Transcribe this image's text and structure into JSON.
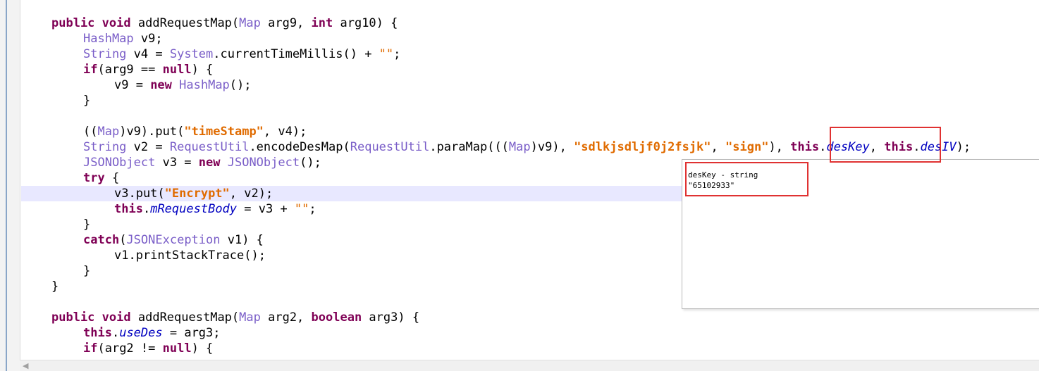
{
  "code": {
    "l1": {
      "kw1": "public",
      "kw2": "void",
      "name": " addRequestMap(",
      "ty": "Map",
      "a": " arg9, ",
      "kw3": "int",
      "b": " arg10) {"
    },
    "l2": {
      "ty": "HashMap",
      "rest": " v9;"
    },
    "l3": {
      "ty1": "String",
      "a": " v4 = ",
      "ty2": "System",
      "b": ".currentTimeMillis() + ",
      "str": "\"\"",
      "c": ";"
    },
    "l4": {
      "kw": "if",
      "a": "(arg9 == ",
      "kw2": "null",
      "b": ") {"
    },
    "l5": {
      "a": "v9 = ",
      "kw": "new",
      "ty": " HashMap",
      "b": "();"
    },
    "l6": {
      "a": "}"
    },
    "l7": {
      "a": "((",
      "ty": "Map",
      "b": ")v9).put(",
      "str": "\"timeStamp\"",
      "c": ", v4);"
    },
    "l8": {
      "ty1": "String",
      "a": " v2 = ",
      "ty2": "RequestUtil",
      "b": ".encodeDesMap(",
      "ty3": "RequestUtil",
      "c": ".paraMap(((",
      "ty4": "Map",
      "d": ")v9), ",
      "str1": "\"sdlkjsdljf0j2fsjk\"",
      "e": ", ",
      "str2": "\"sign\"",
      "f": "), ",
      "kw1": "this",
      "g": ".",
      "fld1": "desKey",
      "h": ", ",
      "kw2": "this",
      "i": ".",
      "fld2": "desIV",
      "j": ");"
    },
    "l9": {
      "ty1": "JSONObject",
      "a": " v3 = ",
      "kw": "new",
      "ty2": " JSONObject",
      "b": "();"
    },
    "l10": {
      "kw": "try",
      "a": " {"
    },
    "l11": {
      "a": "v3.put(",
      "str": "\"Encrypt\"",
      "b": ", v2);"
    },
    "l12": {
      "kw": "this",
      "a": ".",
      "fld": "mRequestBody",
      "b": " = v3 + ",
      "str": "\"\"",
      "c": ";"
    },
    "l13": {
      "a": "}"
    },
    "l14": {
      "kw": "catch",
      "a": "(",
      "ty": "JSONException",
      "b": " v1) {"
    },
    "l15": {
      "a": "v1.printStackTrace();"
    },
    "l16": {
      "a": "}"
    },
    "l17": {
      "a": "}"
    },
    "l18": {
      "kw1": "public",
      "kw2": "void",
      "name": " addRequestMap(",
      "ty": "Map",
      "a": " arg2, ",
      "kw3": "boolean",
      "b": " arg3) {"
    },
    "l19": {
      "kw": "this",
      "a": ".",
      "fld": "useDes",
      "b": " = arg3;"
    },
    "l20": {
      "kw": "if",
      "a": "(arg2 != ",
      "kw2": "null",
      "b": ") {"
    }
  },
  "hover": {
    "line1": "desKey - string",
    "line2": "\"65102933\""
  },
  "colors": {
    "keyword": "#7f0055",
    "type": "#7a5ec8",
    "string": "#e06b00",
    "field": "#0000c0",
    "highlight": "#e8e8ff",
    "annotation": "#e03232"
  }
}
